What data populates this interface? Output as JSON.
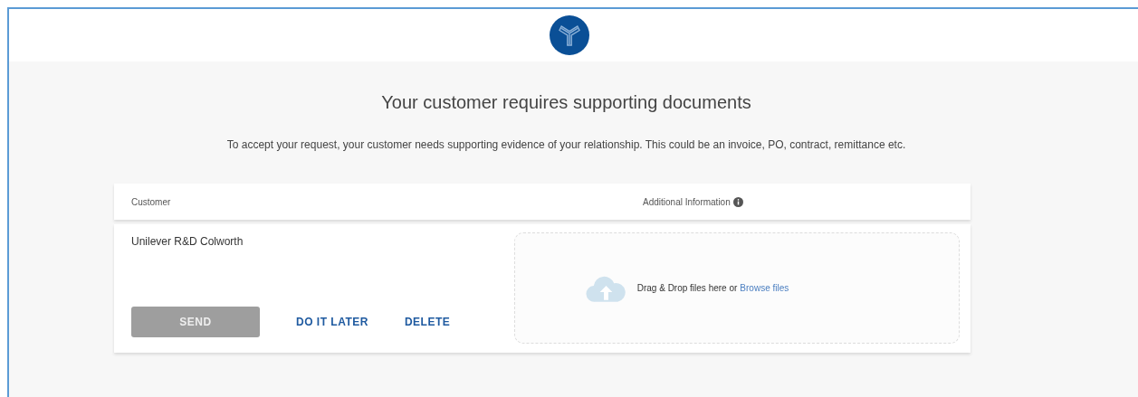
{
  "heading": "Your customer requires supporting documents",
  "description": "To accept your request, your customer needs supporting evidence of your relationship. This could be an invoice, PO, contract, remittance etc.",
  "table": {
    "columns": [
      "Customer",
      "Additional Information"
    ],
    "row": {
      "customer": "Unilever R&D Colworth",
      "actions": [
        {
          "label": "SEND",
          "kind": "primary",
          "disabled": true
        },
        {
          "label": "DO IT LATER",
          "kind": "text",
          "disabled": false
        },
        {
          "label": "DELETE",
          "kind": "text",
          "disabled": false
        }
      ],
      "dropzone": {
        "text": "Drag & Drop files here or",
        "link": "Browse files"
      }
    }
  }
}
